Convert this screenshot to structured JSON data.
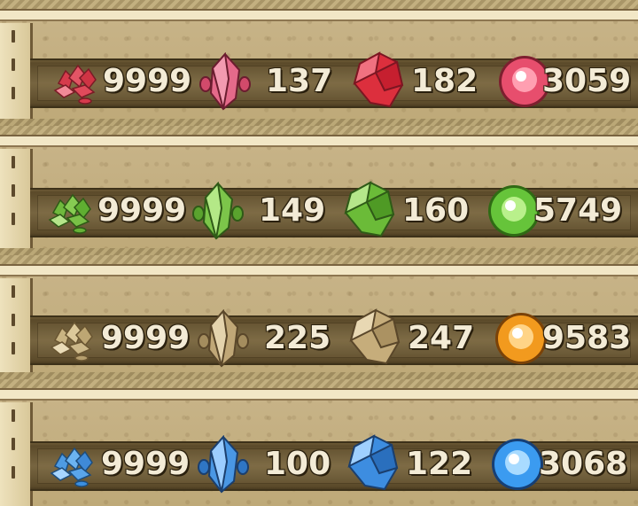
{
  "rows": [
    {
      "color": "red",
      "accent": "#d63b4c",
      "light": "#f28a97",
      "values": [
        "9999",
        "137",
        "182",
        "3059"
      ],
      "icons": [
        "red-ore-cluster-icon",
        "red-small-crystal-icon",
        "red-large-crystal-icon",
        "red-orb-icon"
      ]
    },
    {
      "color": "green",
      "accent": "#58a82e",
      "light": "#a9e07a",
      "values": [
        "9999",
        "149",
        "160",
        "5749"
      ],
      "icons": [
        "green-ore-cluster-icon",
        "green-small-crystal-icon",
        "green-large-crystal-icon",
        "green-orb-icon"
      ]
    },
    {
      "color": "tan",
      "accent": "#b59e6e",
      "light": "#e6d6ad",
      "orb": "#f29a1e",
      "values": [
        "9999",
        "225",
        "247",
        "9583"
      ],
      "icons": [
        "tan-ore-cluster-icon",
        "tan-small-crystal-icon",
        "tan-large-crystal-icon",
        "orange-orb-icon"
      ]
    },
    {
      "color": "blue",
      "accent": "#3b8fe0",
      "light": "#9cd0ff",
      "values": [
        "9999",
        "100",
        "122",
        "3068"
      ],
      "icons": [
        "blue-ore-cluster-icon",
        "blue-small-crystal-icon",
        "blue-large-crystal-icon",
        "blue-orb-icon"
      ]
    }
  ]
}
